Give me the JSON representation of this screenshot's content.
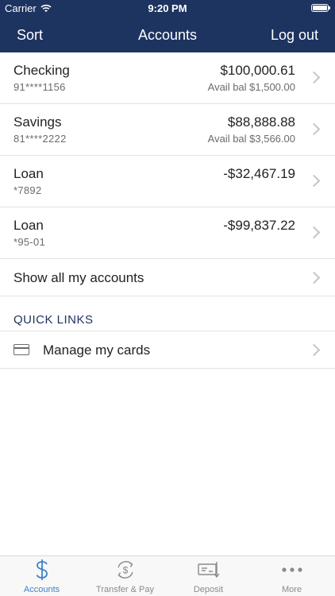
{
  "status_bar": {
    "carrier": "Carrier",
    "time": "9:20 PM"
  },
  "nav": {
    "left": "Sort",
    "title": "Accounts",
    "right": "Log out"
  },
  "accounts": [
    {
      "name": "Checking",
      "number": "91****1156",
      "amount": "$100,000.61",
      "avail": "Avail bal $1,500.00"
    },
    {
      "name": "Savings",
      "number": "81****2222",
      "amount": "$88,888.88",
      "avail": "Avail bal $3,566.00"
    },
    {
      "name": "Loan",
      "number": "*7892",
      "amount": "-$32,467.19",
      "avail": ""
    },
    {
      "name": "Loan",
      "number": "*95-01",
      "amount": "-$99,837.22",
      "avail": ""
    }
  ],
  "show_all": "Show all my accounts",
  "quick_links": {
    "heading": "QUICK LINKS",
    "items": [
      {
        "label": "Manage my cards",
        "icon": "credit-card-icon"
      }
    ]
  },
  "tabbar": {
    "tabs": [
      {
        "label": "Accounts",
        "icon": "dollar-icon",
        "active": true
      },
      {
        "label": "Transfer & Pay",
        "icon": "transfer-dollar-icon",
        "active": false
      },
      {
        "label": "Deposit",
        "icon": "check-deposit-icon",
        "active": false
      },
      {
        "label": "More",
        "icon": "more-dots-icon",
        "active": false
      }
    ]
  },
  "colors": {
    "header_bg": "#1d3360",
    "accent": "#3e82c7",
    "section_heading": "#1d3360"
  }
}
